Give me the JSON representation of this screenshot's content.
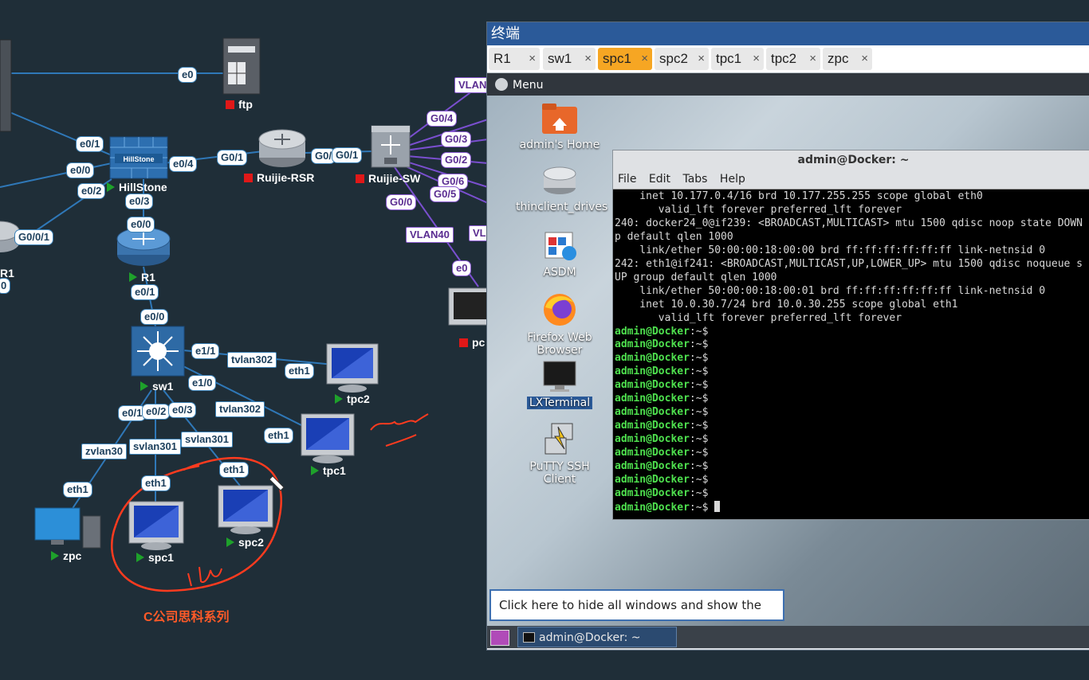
{
  "topology": {
    "devices": {
      "ftp": "ftp",
      "hillstone": "HillStone",
      "ruijie_rsr": "Ruijie-RSR",
      "ruijie_sw": "Ruijie-SW",
      "r1": "R1",
      "r1_left": "R1",
      "sw1": "sw1",
      "tpc2": "tpc2",
      "tpc1": "tpc1",
      "zpc": "zpc",
      "spc1": "spc1",
      "spc2": "spc2",
      "pc": "pc"
    },
    "links": {
      "ftp_e0": "e0",
      "hs_e01": "e0/1",
      "hs_e00": "e0/0",
      "hs_e02": "e0/2",
      "hs_e04": "e0/4",
      "hs_e03": "e0/3",
      "rsr_g01": "G0/1",
      "rsr_g0": "G0/",
      "rsw_g01": "G0/1",
      "r1l_g001": "G0/0/1",
      "r1l_0": "0",
      "r1_e00": "e0/0",
      "r1_e01": "e0/1",
      "sw1_e00": "e0/0",
      "sw1_e11": "e1/1",
      "sw1_e10": "e1/0",
      "sw1_e01": "e0/1",
      "sw1_e02": "e0/2",
      "sw1_e03": "e0/3",
      "tvlan302_a": "tvlan302",
      "tvlan302_b": "tvlan302",
      "tpc2_eth1": "eth1",
      "tpc1_eth1": "eth1",
      "zvlan30": "zvlan30",
      "svlan301_a": "svlan301",
      "svlan301_b": "svlan301",
      "zpc_eth1": "eth1",
      "spc1_eth1": "eth1",
      "spc2_eth1": "eth1",
      "rsw_g00": "G0/0",
      "rsw_g04": "G0/4",
      "rsw_g03": "G0/3",
      "rsw_g02": "G0/2",
      "rsw_g06": "G0/6",
      "rsw_g05": "G0/5",
      "vlan_top": "VLAN",
      "vlan40": "VLAN40",
      "vlan_right": "VL",
      "pc_e0": "e0"
    },
    "annotation": "C公司思科系列"
  },
  "terminal": {
    "window_title": "终端",
    "tabs": [
      {
        "label": "R1",
        "active": false
      },
      {
        "label": "sw1",
        "active": false
      },
      {
        "label": "spc1",
        "active": true
      },
      {
        "label": "spc2",
        "active": false
      },
      {
        "label": "tpc1",
        "active": false
      },
      {
        "label": "tpc2",
        "active": false
      },
      {
        "label": "zpc",
        "active": false
      }
    ],
    "tab_close": "×",
    "menu": "Menu",
    "desktop_icons": {
      "home": "admin's Home",
      "drives": "thinclient_drives",
      "asdm": "ASDM",
      "firefox": "Firefox Web Browser",
      "lxterminal": "LXTerminal",
      "putty": "PuTTY SSH Client"
    },
    "inner_window": {
      "title": "admin@Docker: ~",
      "menu": [
        "File",
        "Edit",
        "Tabs",
        "Help"
      ],
      "output": [
        "    inet 10.177.0.4/16 brd 10.177.255.255 scope global eth0",
        "       valid_lft forever preferred_lft forever",
        "240: docker24_0@if239: <BROADCAST,MULTICAST> mtu 1500 qdisc noop state DOWN",
        "p default qlen 1000",
        "    link/ether 50:00:00:18:00:00 brd ff:ff:ff:ff:ff:ff link-netnsid 0",
        "242: eth1@if241: <BROADCAST,MULTICAST,UP,LOWER_UP> mtu 1500 qdisc noqueue s",
        "UP group default qlen 1000",
        "    link/ether 50:00:00:18:00:01 brd ff:ff:ff:ff:ff:ff link-netnsid 0",
        "    inet 10.0.30.7/24 brd 10.0.30.255 scope global eth1",
        "       valid_lft forever preferred_lft forever"
      ],
      "prompt": "admin@Docker",
      "prompt_suffix": ":~$ ",
      "prompt_count": 14
    },
    "tooltip": "Click here to hide all windows and show the desktop.",
    "taskbar_item": "admin@Docker: ~"
  },
  "colors": {
    "background": "#1f2e38",
    "active_tab": "#f6a623",
    "title_bar": "#2b5a99",
    "prompt_green": "#4ee04e",
    "annotation_red": "#ff3b1f"
  }
}
